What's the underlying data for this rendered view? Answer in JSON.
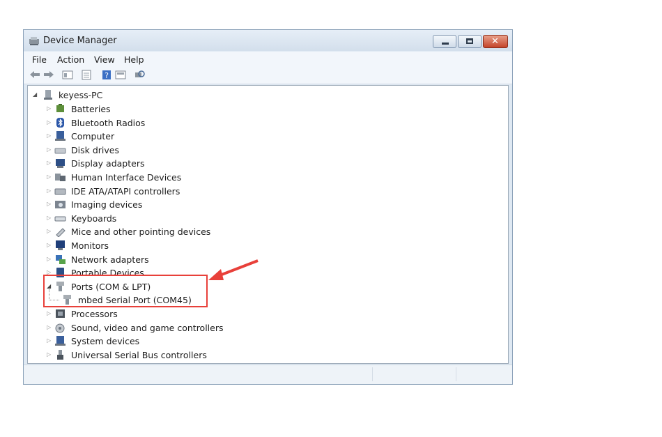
{
  "window": {
    "title": "Device Manager"
  },
  "menu": {
    "file": "File",
    "action": "Action",
    "view": "View",
    "help": "Help"
  },
  "toolbar_icons": [
    "back-arrow-icon",
    "forward-arrow-icon",
    "show-hide-tree-icon",
    "properties-icon",
    "help-icon",
    "view-icon",
    "scan-hardware-icon"
  ],
  "tree": {
    "root": "keyess-PC",
    "categories": [
      {
        "label": "Batteries",
        "icon": "battery-icon"
      },
      {
        "label": "Bluetooth Radios",
        "icon": "bluetooth-icon"
      },
      {
        "label": "Computer",
        "icon": "computer-icon"
      },
      {
        "label": "Disk drives",
        "icon": "disk-drive-icon"
      },
      {
        "label": "Display adapters",
        "icon": "display-adapter-icon"
      },
      {
        "label": "Human Interface Devices",
        "icon": "hid-icon"
      },
      {
        "label": "IDE ATA/ATAPI controllers",
        "icon": "ide-controller-icon"
      },
      {
        "label": "Imaging devices",
        "icon": "imaging-device-icon"
      },
      {
        "label": "Keyboards",
        "icon": "keyboard-icon"
      },
      {
        "label": "Mice and other pointing devices",
        "icon": "mouse-icon"
      },
      {
        "label": "Monitors",
        "icon": "monitor-icon"
      },
      {
        "label": "Network adapters",
        "icon": "network-adapter-icon"
      },
      {
        "label": "Portable Devices",
        "icon": "portable-device-icon"
      },
      {
        "label": "Ports (COM & LPT)",
        "icon": "port-icon",
        "expanded": true
      },
      {
        "label": "mbed Serial Port (COM45)",
        "icon": "serial-port-icon",
        "child": true
      },
      {
        "label": "Processors",
        "icon": "processor-icon"
      },
      {
        "label": "Sound, video and game controllers",
        "icon": "sound-icon"
      },
      {
        "label": "System devices",
        "icon": "system-device-icon"
      },
      {
        "label": "Universal Serial Bus controllers",
        "icon": "usb-icon"
      }
    ]
  },
  "colors": {
    "highlight": "#e8403a",
    "window_bg": "#dfe9f3"
  }
}
